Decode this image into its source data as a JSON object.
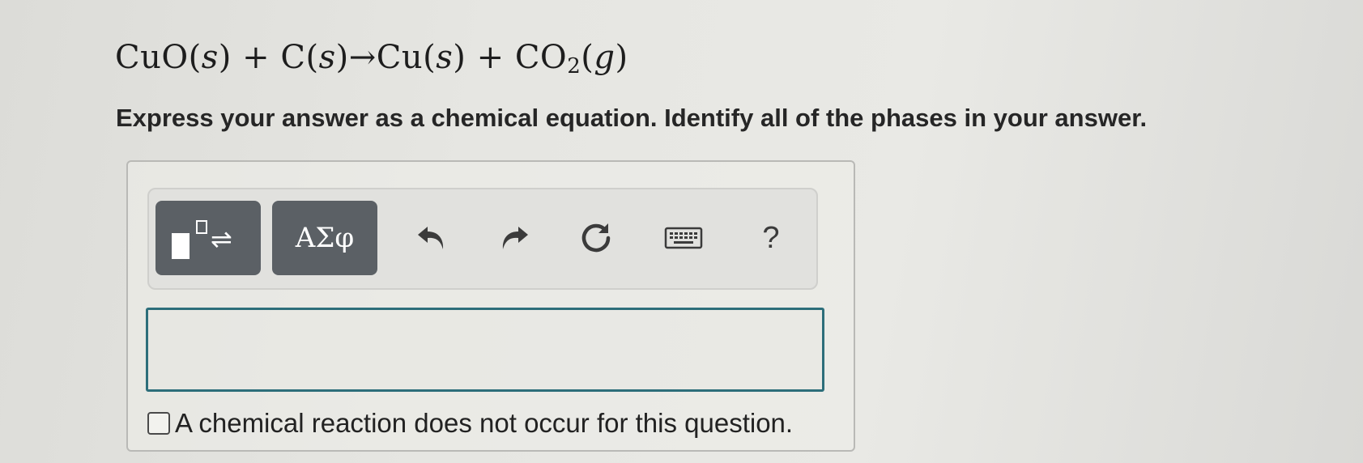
{
  "question": {
    "equation": {
      "r1": "CuO(",
      "r1_phase": "s",
      "r1_close": ")",
      "plus1": " + ",
      "r2": "C(",
      "r2_phase": "s",
      "r2_close": ")",
      "arrow": "→",
      "p1": "Cu(",
      "p1_phase": "s",
      "p1_close": ")",
      "plus2": " + ",
      "p2": "CO",
      "p2_sub": "2",
      "p2_open": "(",
      "p2_phase": "g",
      "p2_close": ")"
    },
    "instruction": "Express your answer as a chemical equation. Identify all of the phases in your answer."
  },
  "toolbar": {
    "symbols_label": "ΑΣφ",
    "template_arrows": "⇌",
    "help_label": "?",
    "icons": [
      "templates-icon",
      "undo-icon",
      "redo-icon",
      "reset-icon",
      "keyboard-icon",
      "help-icon"
    ]
  },
  "answer": {
    "value": ""
  },
  "no_reaction": {
    "label": "A chemical reaction does not occur for this question.",
    "checked": false
  },
  "colors": {
    "button_bg": "#5b6065",
    "input_border": "#2d6e7a"
  }
}
